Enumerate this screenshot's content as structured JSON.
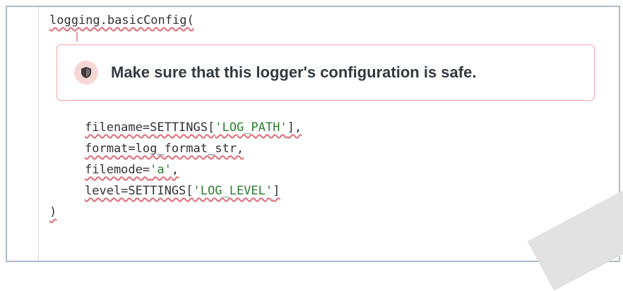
{
  "code": {
    "line1": "logging.basicConfig(",
    "line_filename_pre": "filename=SETTINGS[",
    "line_filename_str": "'LOG_PATH'",
    "line_filename_post": "],",
    "line_format": "format=log_format_str,",
    "line_filemode_pre": "filemode=",
    "line_filemode_str": "'a'",
    "line_filemode_post": ",",
    "line_level_pre": "level=SETTINGS[",
    "line_level_str": "'LOG_LEVEL'",
    "line_level_post": "]",
    "line_close": ")"
  },
  "issue": {
    "message": "Make sure that this logger's configuration is safe.",
    "icon": "shield-icon"
  },
  "colors": {
    "squiggle": "#e06c75",
    "string": "#2e7d32",
    "issue_border": "#f0a8a8"
  }
}
